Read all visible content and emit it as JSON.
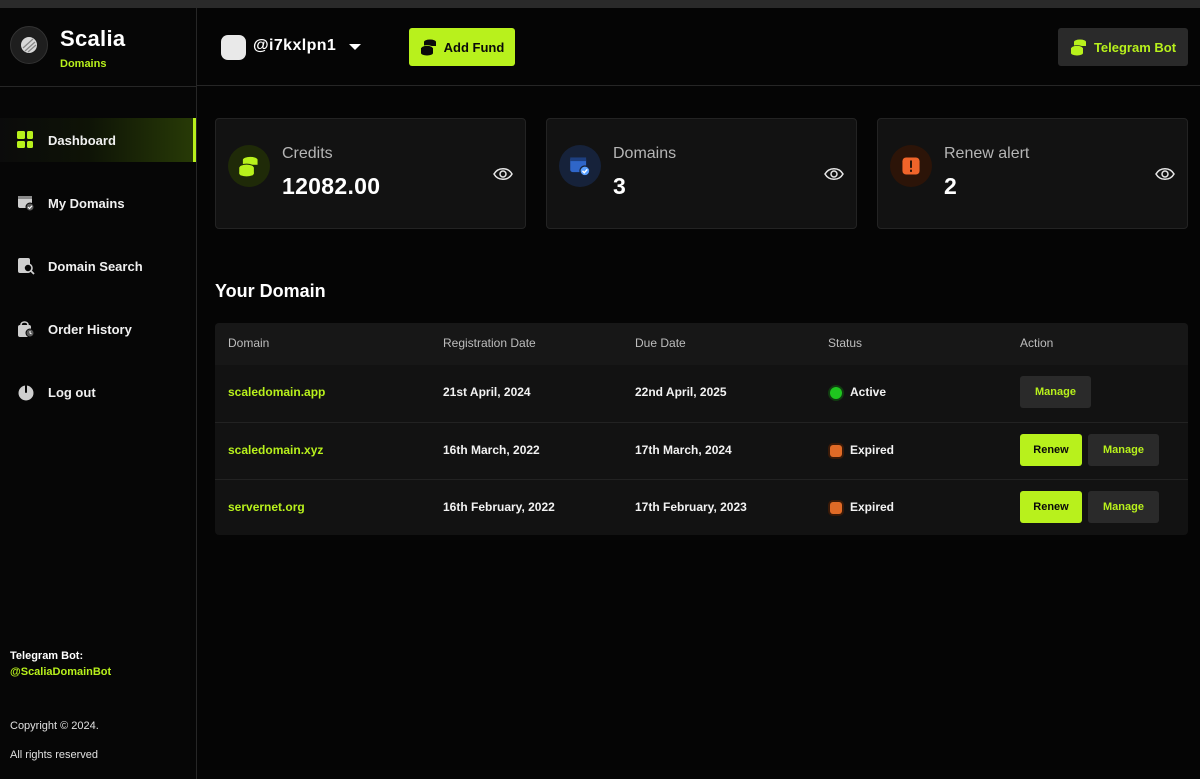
{
  "brand": {
    "name": "Scalia",
    "subtitle": "Domains"
  },
  "sidebar": {
    "items": [
      {
        "label": "Dashboard",
        "icon": "dashboard-grid-icon",
        "active": true
      },
      {
        "label": "My Domains",
        "icon": "domain-window-icon",
        "active": false
      },
      {
        "label": "Domain Search",
        "icon": "search-doc-icon",
        "active": false
      },
      {
        "label": "Order History",
        "icon": "history-bag-icon",
        "active": false
      },
      {
        "label": "Log out",
        "icon": "power-icon",
        "active": false
      }
    ],
    "telegram_label": "Telegram Bot:",
    "telegram_handle": "@ScaliaDomainBot",
    "copyright": "Copyright © 2024.",
    "rights": "All rights reserved"
  },
  "header": {
    "username": "@i7kxlpn1",
    "add_fund_label": "Add Fund",
    "telegram_button_label": "Telegram Bot"
  },
  "stats": [
    {
      "label": "Credits",
      "value": "12082.00",
      "icon": "coins-icon"
    },
    {
      "label": "Domains",
      "value": "3",
      "icon": "domain-check-icon"
    },
    {
      "label": "Renew alert",
      "value": "2",
      "icon": "alert-icon"
    }
  ],
  "domains_section": {
    "title": "Your Domain",
    "columns": [
      "Domain",
      "Registration Date",
      "Due Date",
      "Status",
      "Action"
    ],
    "rows": [
      {
        "domain": "scaledomain.app",
        "registered": "21st April, 2024",
        "due": "22nd April, 2025",
        "status": "Active",
        "renew": null,
        "manage": "Manage"
      },
      {
        "domain": "scaledomain.xyz",
        "registered": "16th March, 2022",
        "due": "17th March, 2024",
        "status": "Expired",
        "renew": "Renew",
        "manage": "Manage"
      },
      {
        "domain": "servernet.org",
        "registered": "16th February, 2022",
        "due": "17th February, 2023",
        "status": "Expired",
        "renew": "Renew",
        "manage": "Manage"
      }
    ]
  },
  "colors": {
    "accent": "#b8f11c",
    "background": "#050505",
    "card": "#121212",
    "active_status": "#1fc51f",
    "expired_status": "#e06a26"
  }
}
